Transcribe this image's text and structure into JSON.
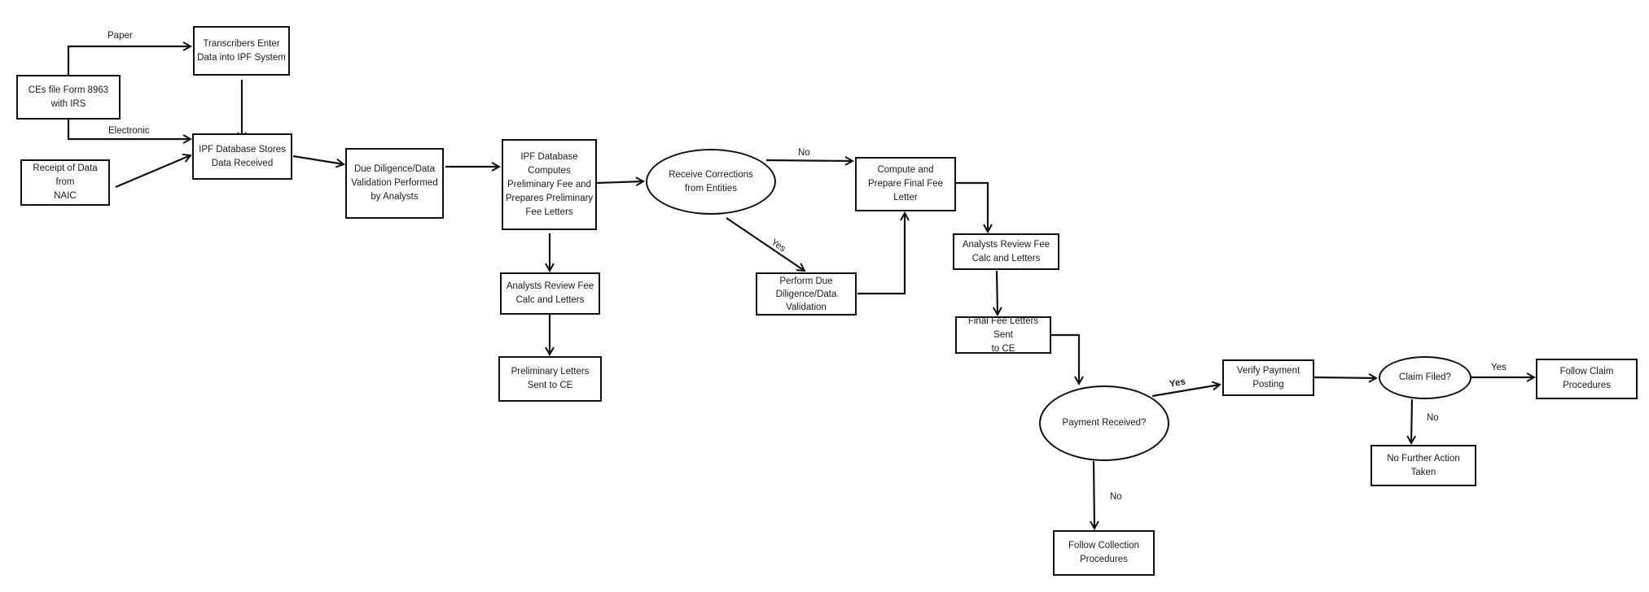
{
  "diagram": {
    "nodes": {
      "ces_file": "CEs file Form 8963\nwith IRS",
      "transcribers": "Transcribers Enter\nData into IPF System",
      "ipf_stores": "IPF Database Stores\nData Received",
      "naic": "Receipt of Data from\nNAIC",
      "due_diligence": "Due Diligence/Data\nValidation Performed\nby Analysts",
      "ipf_computes": "IPF Database\nComputes\nPreliminary Fee and\nPrepares Preliminary\nFee Letters",
      "analysts_review_1": "Analysts Review Fee\nCalc and Letters",
      "preliminary_letters": "Preliminary Letters\nSent to CE",
      "receive_corrections": "Receive Corrections\nfrom Entities",
      "perform_due_diligence": "Perform Due\nDiligence/Data\nValidation",
      "compute_final": "Compute and\nPrepare Final Fee\nLetter",
      "analysts_review_2": "Analysts Review Fee\nCalc and Letters",
      "final_letters": "Final Fee Letters Sent\nto CE",
      "payment_received": "Payment Received?",
      "verify_payment": "Verify Payment\nPosting",
      "follow_collection": "Follow Collection\nProcedures",
      "claim_filed": "Claim Filed?",
      "follow_claim": "Follow Claim\nProcedures",
      "no_further_action": "No Further Action\nTaken"
    },
    "edge_labels": {
      "paper": "Paper",
      "electronic": "Electronic",
      "corrections_no": "No",
      "corrections_yes": "Yes",
      "payment_yes": "Yes",
      "payment_no": "No",
      "claim_yes": "Yes",
      "claim_no": "No"
    },
    "colors": {
      "stroke": "#111111",
      "background": "#ffffff"
    }
  }
}
